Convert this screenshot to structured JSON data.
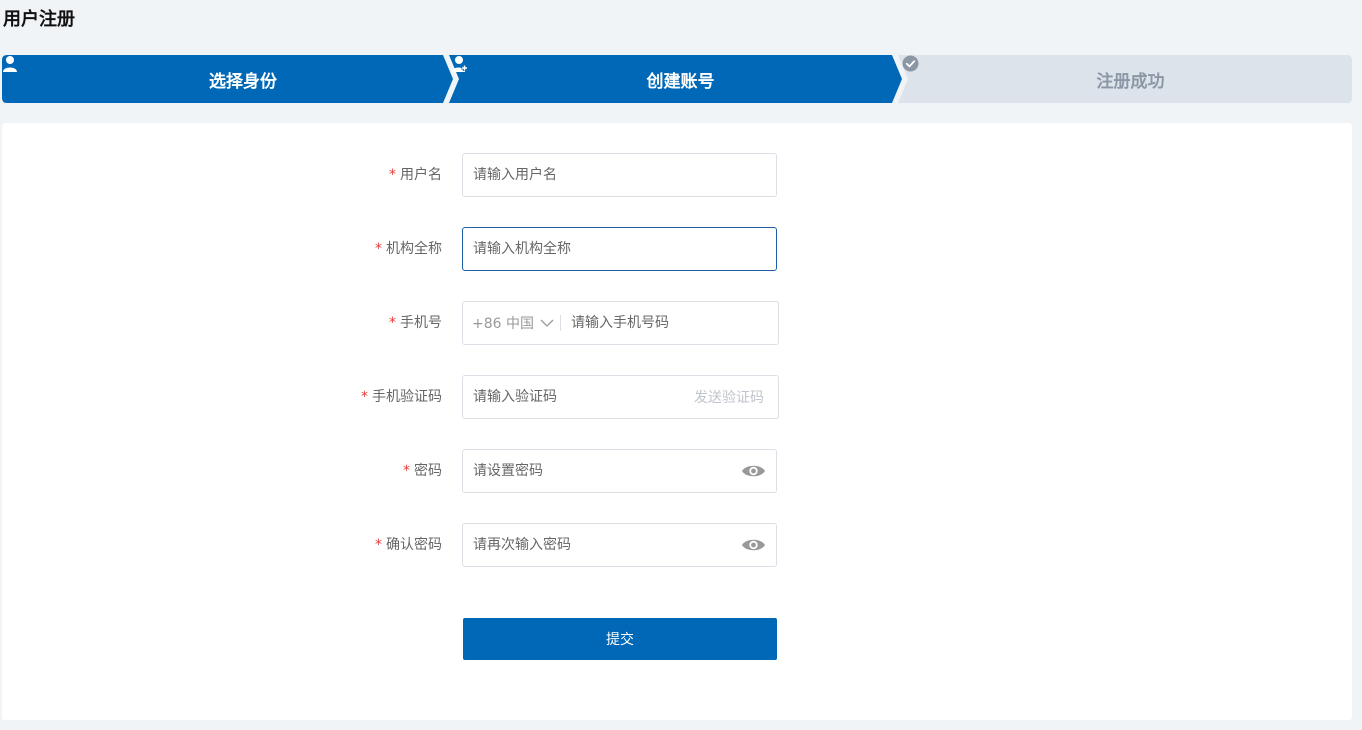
{
  "page_title": "用户注册",
  "steps": [
    {
      "label": "选择身份",
      "icon": "user-icon",
      "active": true
    },
    {
      "label": "创建账号",
      "icon": "user-add-icon",
      "active": true
    },
    {
      "label": "注册成功",
      "icon": "check-circle-icon",
      "active": false
    }
  ],
  "colors": {
    "primary": "#0068b7",
    "step_inactive": "#dce3ea",
    "required": "#e53935",
    "page_bg": "#f1f4f7"
  },
  "form": {
    "required_mark": "*",
    "username": {
      "label": "用户名",
      "placeholder": "请输入用户名"
    },
    "org_name": {
      "label": "机构全称",
      "placeholder": "请输入机构全称"
    },
    "phone": {
      "label": "手机号",
      "country_code": "+86 中国",
      "placeholder": "请输入手机号码"
    },
    "sms_code": {
      "label": "手机验证码",
      "placeholder": "请输入验证码",
      "send_label": "发送验证码"
    },
    "password": {
      "label": "密码",
      "placeholder": "请设置密码",
      "icon": "eye-icon"
    },
    "confirm_password": {
      "label": "确认密码",
      "placeholder": "请再次输入密码",
      "icon": "eye-icon"
    },
    "submit_label": "提交"
  }
}
